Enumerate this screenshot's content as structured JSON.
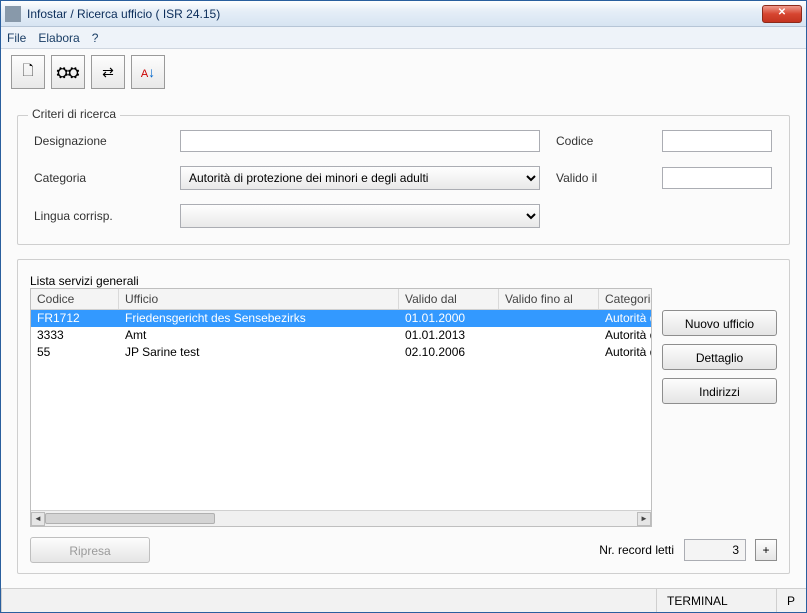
{
  "window": {
    "title": "Infostar / Ricerca ufficio ( ISR 24.15)"
  },
  "menu": {
    "file": "File",
    "elabora": "Elabora",
    "help": "?"
  },
  "toolbar_icons": {
    "new": "document-icon",
    "find": "binoculars-icon",
    "link": "replace-icon",
    "sort": "sort-az-icon"
  },
  "search": {
    "legend": "Criteri di ricerca",
    "labels": {
      "designazione": "Designazione",
      "categoria": "Categoria",
      "lingua": "Lingua corrisp.",
      "codice": "Codice",
      "valido": "Valido il"
    },
    "values": {
      "designazione": "",
      "categoria_selected": "Autorità di protezione dei minori e degli adulti",
      "lingua_selected": "",
      "codice": "",
      "valido": ""
    }
  },
  "list": {
    "legend": "Lista servizi generali",
    "columns": {
      "codice": "Codice",
      "ufficio": "Ufficio",
      "valido_dal": "Valido dal",
      "valido_fino": "Valido fino al",
      "categoria": "Categoria"
    },
    "rows": [
      {
        "codice": "FR1712",
        "ufficio": "Friedensgericht des Sensebezirks",
        "valido_dal": "01.01.2000",
        "valido_fino": "",
        "categoria": "Autorità di",
        "selected": true
      },
      {
        "codice": "3333",
        "ufficio": "Amt",
        "valido_dal": "01.01.2013",
        "valido_fino": "",
        "categoria": "Autorità di",
        "selected": false
      },
      {
        "codice": "55",
        "ufficio": "JP Sarine test",
        "valido_dal": "02.10.2006",
        "valido_fino": "",
        "categoria": "Autorità di",
        "selected": false
      }
    ],
    "buttons": {
      "nuovo": "Nuovo ufficio",
      "dettaglio": "Dettaglio",
      "indirizzi": "Indirizzi"
    },
    "bottom": {
      "ripresa": "Ripresa",
      "record_label": "Nr. record letti",
      "record_count": "3",
      "step": "+"
    }
  },
  "status": {
    "terminal": "TERMINAL",
    "p": "P"
  }
}
